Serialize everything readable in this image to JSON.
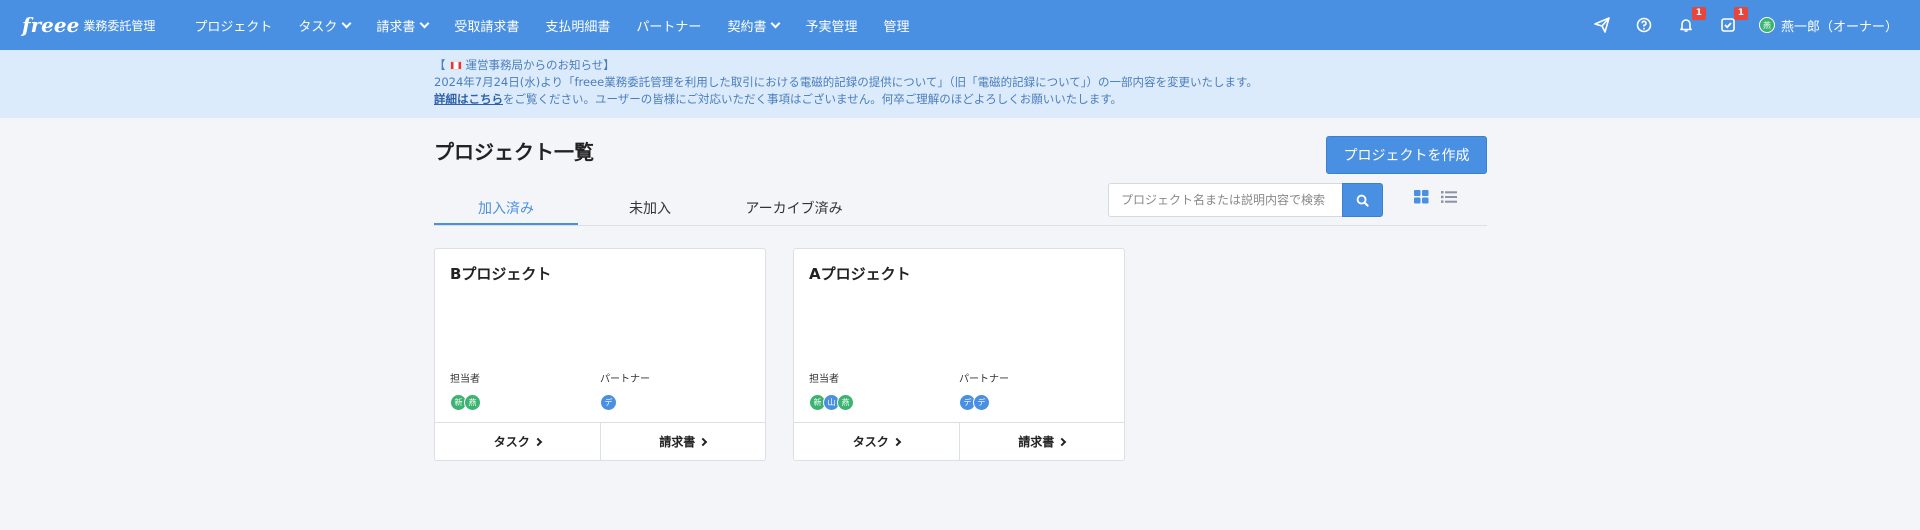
{
  "header": {
    "logo_mark": "freee",
    "logo_text": "業務委託管理",
    "nav": [
      {
        "label": "プロジェクト",
        "dropdown": false
      },
      {
        "label": "タスク",
        "dropdown": true
      },
      {
        "label": "請求書",
        "dropdown": true
      },
      {
        "label": "受取請求書",
        "dropdown": false
      },
      {
        "label": "支払明細書",
        "dropdown": false
      },
      {
        "label": "パートナー",
        "dropdown": false
      },
      {
        "label": "契約書",
        "dropdown": true
      },
      {
        "label": "予実管理",
        "dropdown": false
      },
      {
        "label": "管理",
        "dropdown": false
      }
    ],
    "notifications_count": "1",
    "tasks_count": "1",
    "user_avatar": "燕",
    "user_name": "燕一郎（オーナー）"
  },
  "notice": {
    "title_left": "【",
    "title_text": "運営事務局からのお知らせ",
    "title_right": "】",
    "line1": "2024年7月24日(水)より「freee業務委託管理を利用した取引における電磁的記録の提供について」（旧「電磁的記録について」）の一部内容を変更いたします。",
    "link": "詳細はこちら",
    "line2": "をご覧ください。ユーザーの皆様にご対応いただく事項はございません。何卒ご理解のほどよろしくお願いいたします。"
  },
  "main": {
    "title": "プロジェクト一覧",
    "create_button": "プロジェクトを作成",
    "tabs": [
      "加入済み",
      "未加入",
      "アーカイブ済み"
    ],
    "search_placeholder": "プロジェクト名または説明内容で検索",
    "projects": [
      {
        "name": "Bプロジェクト",
        "assignee_label": "担当者",
        "partner_label": "パートナー",
        "assignees": [
          {
            "initial": "新",
            "color": "green"
          },
          {
            "initial": "燕",
            "color": "green"
          }
        ],
        "partners": [
          {
            "initial": "デ",
            "color": "blue"
          }
        ],
        "task_label": "タスク",
        "invoice_label": "請求書"
      },
      {
        "name": "Aプロジェクト",
        "assignee_label": "担当者",
        "partner_label": "パートナー",
        "assignees": [
          {
            "initial": "新",
            "color": "green"
          },
          {
            "initial": "山",
            "color": "blue"
          },
          {
            "initial": "燕",
            "color": "green"
          }
        ],
        "partners": [
          {
            "initial": "デ",
            "color": "blue"
          },
          {
            "initial": "デ",
            "color": "blue"
          }
        ],
        "task_label": "タスク",
        "invoice_label": "請求書"
      }
    ]
  }
}
